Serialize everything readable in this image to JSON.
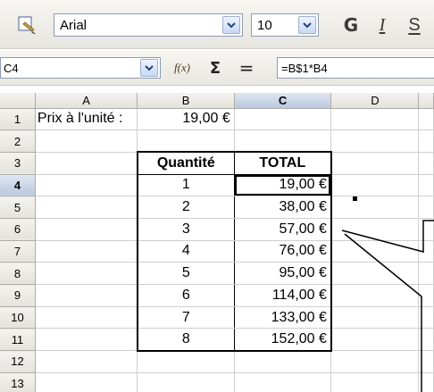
{
  "toolbar": {
    "font_name": "Arial",
    "font_size": "10",
    "bold_label": "G",
    "italic_label": "I",
    "underline_label": "S",
    "icons": {
      "clone_format": "paintbrush-icon",
      "dropdown": "chevron-down-icon"
    }
  },
  "formula_bar": {
    "cell_reference": "C4",
    "function_wizard_label": "f(x)",
    "sum_label": "Σ",
    "equals_label": "=",
    "formula": "=B$1*B4"
  },
  "sheet": {
    "columns": [
      "A",
      "B",
      "C",
      "D"
    ],
    "selected_column": "C",
    "selected_row": "4",
    "rows": [
      {
        "n": "1",
        "a": "Prix à l'unité :",
        "b": "19,00 €",
        "c": ""
      },
      {
        "n": "2",
        "a": "",
        "b": "",
        "c": ""
      },
      {
        "n": "3",
        "a": "",
        "b": "Quantité",
        "c": "TOTAL"
      },
      {
        "n": "4",
        "a": "",
        "b": "1",
        "c": "19,00 €"
      },
      {
        "n": "5",
        "a": "",
        "b": "2",
        "c": "38,00 €"
      },
      {
        "n": "6",
        "a": "",
        "b": "3",
        "c": "57,00 €"
      },
      {
        "n": "7",
        "a": "",
        "b": "4",
        "c": "76,00 €"
      },
      {
        "n": "8",
        "a": "",
        "b": "5",
        "c": "95,00 €"
      },
      {
        "n": "9",
        "a": "",
        "b": "6",
        "c": "114,00 €"
      },
      {
        "n": "10",
        "a": "",
        "b": "7",
        "c": "133,00 €"
      },
      {
        "n": "11",
        "a": "",
        "b": "8",
        "c": "152,00 €"
      },
      {
        "n": "12",
        "a": "",
        "b": "",
        "c": ""
      },
      {
        "n": "13",
        "a": "",
        "b": "",
        "c": ""
      }
    ]
  },
  "colors": {
    "selection_header": "#b9c8de",
    "toolbar_bg": "#e7e5df",
    "grid_line": "#cfcfcf"
  }
}
